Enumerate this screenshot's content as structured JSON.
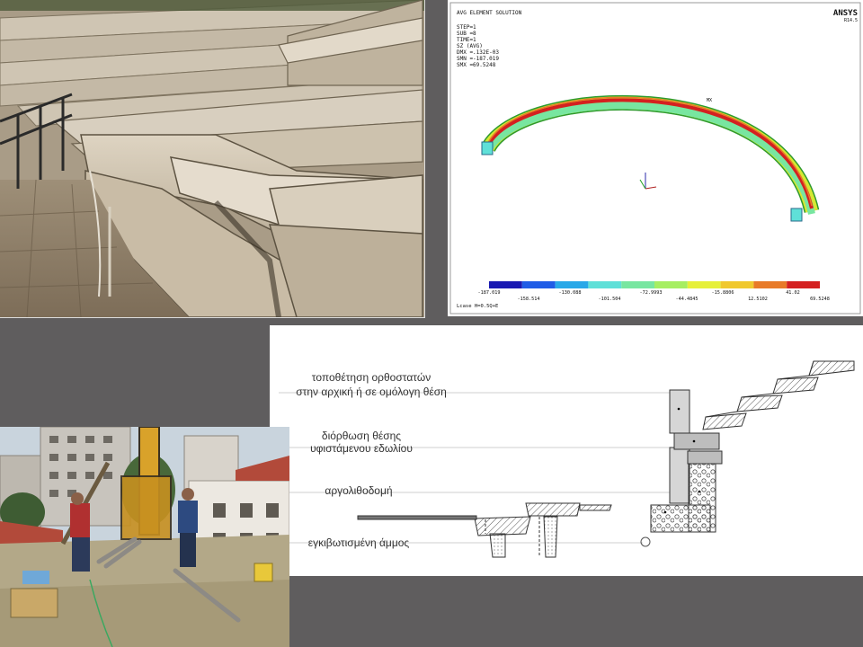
{
  "fea": {
    "brand": "ANSYS",
    "version": "R14.5",
    "header": [
      "AVG ELEMENT SOLUTION",
      "",
      "STEP=1",
      "SUB =8",
      "TIME=1",
      "SZ        (AVG)",
      "DMX =.132E-03",
      "SMN =-187.019",
      "SMX =69.5248"
    ],
    "mx_marker": "MX",
    "footer": "Lcase H=0.5Q+E",
    "legend_top": [
      "-187.019",
      "-130.088",
      "-72.9993",
      "-15.8806",
      "41.02"
    ],
    "legend_bottom": [
      "-158.514",
      "-101.504",
      "-44.4845",
      "12.5102",
      "69.5248"
    ],
    "legend_colors": [
      "#1a1ab2",
      "#1f5ce6",
      "#28a8e8",
      "#5fe0d8",
      "#78e6a0",
      "#a6ee62",
      "#e6f03a",
      "#f0c82e",
      "#e87a28",
      "#d42020"
    ]
  },
  "section": {
    "labels": [
      {
        "line1": "τοποθέτηση ορθοστατών",
        "line2": "στην αρχική ή σε ομόλογη θέση"
      },
      {
        "line1": "διόρθωση θέσης",
        "line2": "υφιστάμενου εδωλίου"
      },
      {
        "line1": "αργολιθοδομή",
        "line2": ""
      },
      {
        "line1": "εγκιβωτισμένη άμμος",
        "line2": ""
      }
    ]
  }
}
